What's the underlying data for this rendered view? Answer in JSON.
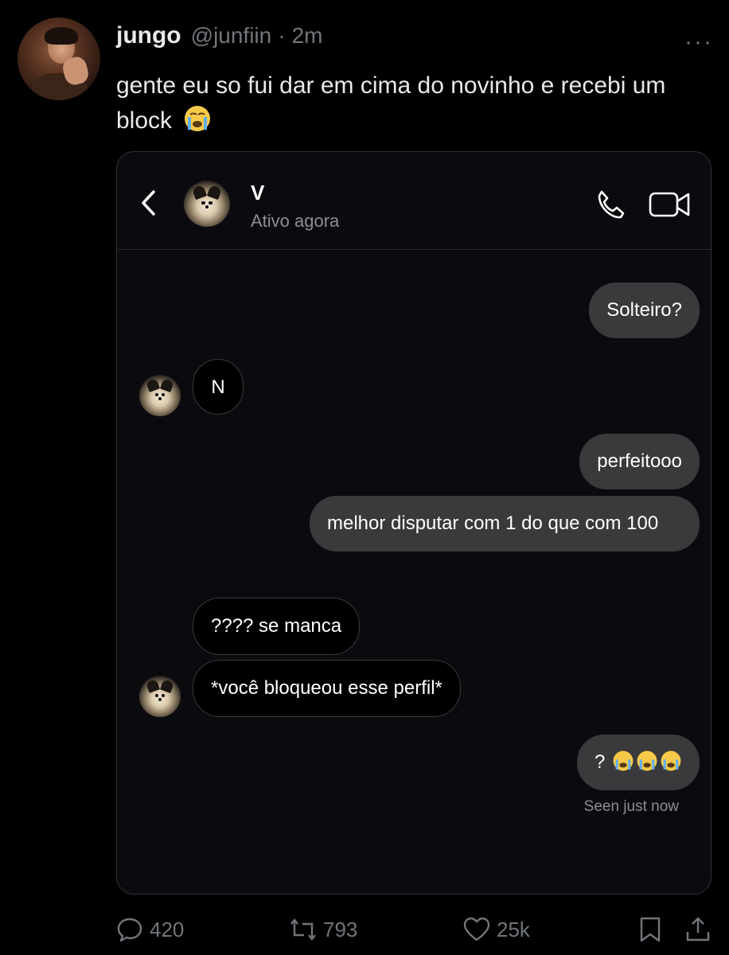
{
  "tweet": {
    "author_name": "jungo",
    "handle": "@junfiin",
    "separator": "·",
    "time": "2m",
    "more_icon": "more-horizontal-icon",
    "more_glyph": "···",
    "text": "gente eu so fui dar em cima do novinho e recebi um block"
  },
  "dm": {
    "contact_name": "V",
    "status": "Ativo agora",
    "messages": [
      {
        "side": "out",
        "text": "Solteiro?"
      },
      {
        "side": "in",
        "text": "N"
      },
      {
        "side": "out",
        "text": "perfeitooo"
      },
      {
        "side": "out",
        "text": "melhor disputar com 1 do que com 100"
      },
      {
        "side": "in",
        "text": "???? se manca"
      },
      {
        "side": "in",
        "text": "*você bloqueou esse perfil*"
      },
      {
        "side": "out",
        "text": "?"
      }
    ],
    "seen": "Seen just now"
  },
  "actions": {
    "replies": "420",
    "retweets": "793",
    "likes": "25k"
  },
  "colors": {
    "background": "#000000",
    "card": "#0b0b0f",
    "outgoing_bubble": "#3a3a3c",
    "muted": "#71767b"
  }
}
